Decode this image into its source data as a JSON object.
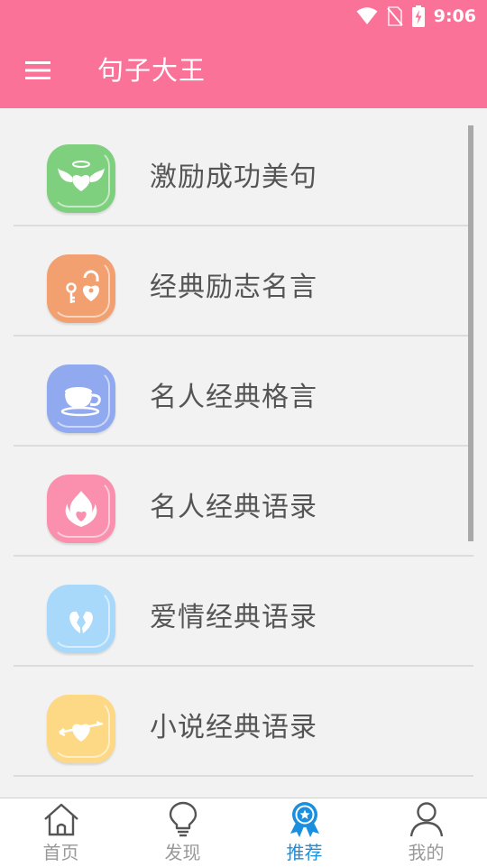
{
  "status_bar": {
    "time": "9:06"
  },
  "app_bar": {
    "title": "句子大王"
  },
  "list": {
    "items": [
      {
        "label": "激励成功美句",
        "icon": "winged-heart-icon",
        "color": "#7ed07e"
      },
      {
        "label": "经典励志名言",
        "icon": "heart-lock-key-icon",
        "color": "#f2a070"
      },
      {
        "label": "名人经典格言",
        "icon": "teacup-icon",
        "color": "#91a9ef"
      },
      {
        "label": "名人经典语录",
        "icon": "flaming-heart-icon",
        "color": "#fb8fae"
      },
      {
        "label": "爱情经典语录",
        "icon": "broken-heart-icon",
        "color": "#a8d9fb"
      },
      {
        "label": "小说经典语录",
        "icon": "arrow-heart-icon",
        "color": "#fdd985"
      }
    ]
  },
  "bottom_nav": {
    "active_color": "#1a8fe0",
    "items": [
      {
        "label": "首页",
        "icon": "home-icon"
      },
      {
        "label": "发现",
        "icon": "lightbulb-icon"
      },
      {
        "label": "推荐",
        "icon": "award-ribbon-icon",
        "active": true
      },
      {
        "label": "我的",
        "icon": "person-icon"
      }
    ]
  }
}
